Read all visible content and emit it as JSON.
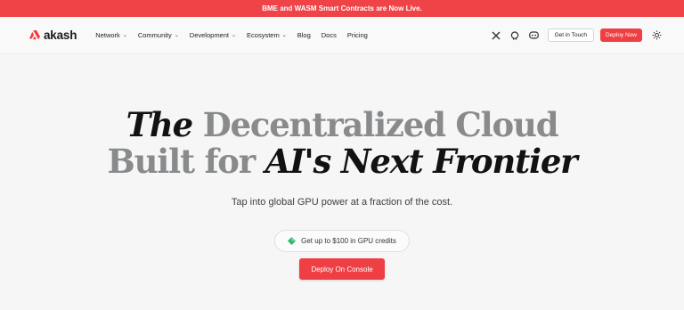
{
  "banner": {
    "text": "BME and WASM Smart Contracts are Now Live."
  },
  "brand": {
    "name": "akash",
    "accent": "#ee3f44"
  },
  "nav": {
    "items": [
      {
        "label": "Network",
        "dropdown": true
      },
      {
        "label": "Community",
        "dropdown": true
      },
      {
        "label": "Development",
        "dropdown": true
      },
      {
        "label": "Ecosystem",
        "dropdown": true
      },
      {
        "label": "Blog",
        "dropdown": false
      },
      {
        "label": "Docs",
        "dropdown": false
      },
      {
        "label": "Pricing",
        "dropdown": false
      }
    ],
    "icons": [
      "x-icon",
      "github-icon",
      "discord-icon"
    ],
    "get_in_touch": "Get in Touch",
    "deploy_now": "Deploy Now",
    "theme_toggle": "sun-icon"
  },
  "hero": {
    "line1_a": "The",
    "line1_b": "Decentralized Cloud",
    "line2_a": "Built for",
    "line2_b": "AI's Next Frontier",
    "subtitle": "Tap into global GPU power at a fraction of the cost.",
    "credits_text": "Get up to $100 in GPU credits",
    "cta": "Deploy On Console"
  }
}
